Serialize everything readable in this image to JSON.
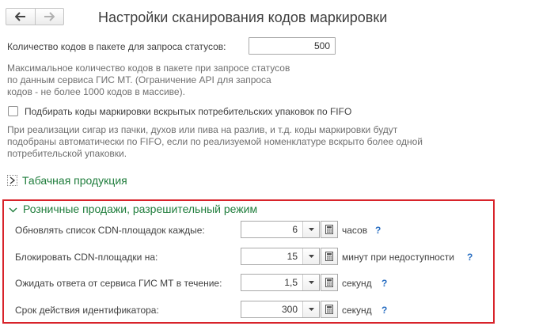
{
  "nav": {
    "back_icon": "arrow-left-icon",
    "forward_icon": "arrow-right-icon"
  },
  "page": {
    "title": "Настройки сканирования кодов маркировки"
  },
  "batch": {
    "label": "Количество кодов в пакете для запроса статусов:",
    "value": "500",
    "hint": [
      "Максимальное количество кодов в пакете при запросе статусов",
      "по данным сервиса ГИС МТ. (Ограничение API для запроса",
      "кодов - не более 1000 кодов в массиве)."
    ]
  },
  "fifo": {
    "checked": false,
    "label": "Подбирать коды маркировки вскрытых потребительских упаковок по FIFO",
    "hint": [
      "При реализации сигар из пачки, духов или пива на разлив, и т.д. коды маркировки будут",
      "подобраны автоматически по FIFO, если по реализуемой номенклатуре вскрыто более одной",
      "потребительской упаковки."
    ]
  },
  "tobacco": {
    "label": "Табачная продукция"
  },
  "retail": {
    "label": "Розничные продажи, разрешительный режим",
    "rows": [
      {
        "label": "Обновлять список CDN-площадок каждые:",
        "value": "6",
        "unit": "часов",
        "help": "?"
      },
      {
        "label": "Блокировать CDN-площадки на:",
        "value": "15",
        "unit": "минут при недоступности",
        "help": "?"
      },
      {
        "label": "Ожидать ответа от сервиса ГИС МТ в течение:",
        "value": "1,5",
        "unit": "секунд",
        "help": "?"
      },
      {
        "label": "Срок действия идентификатора:",
        "value": "300",
        "unit": "секунд",
        "help": "?"
      }
    ]
  },
  "colors": {
    "accent_green": "#1f7d3c",
    "highlight_red": "#d8232a",
    "help_blue": "#2a6fc2"
  }
}
